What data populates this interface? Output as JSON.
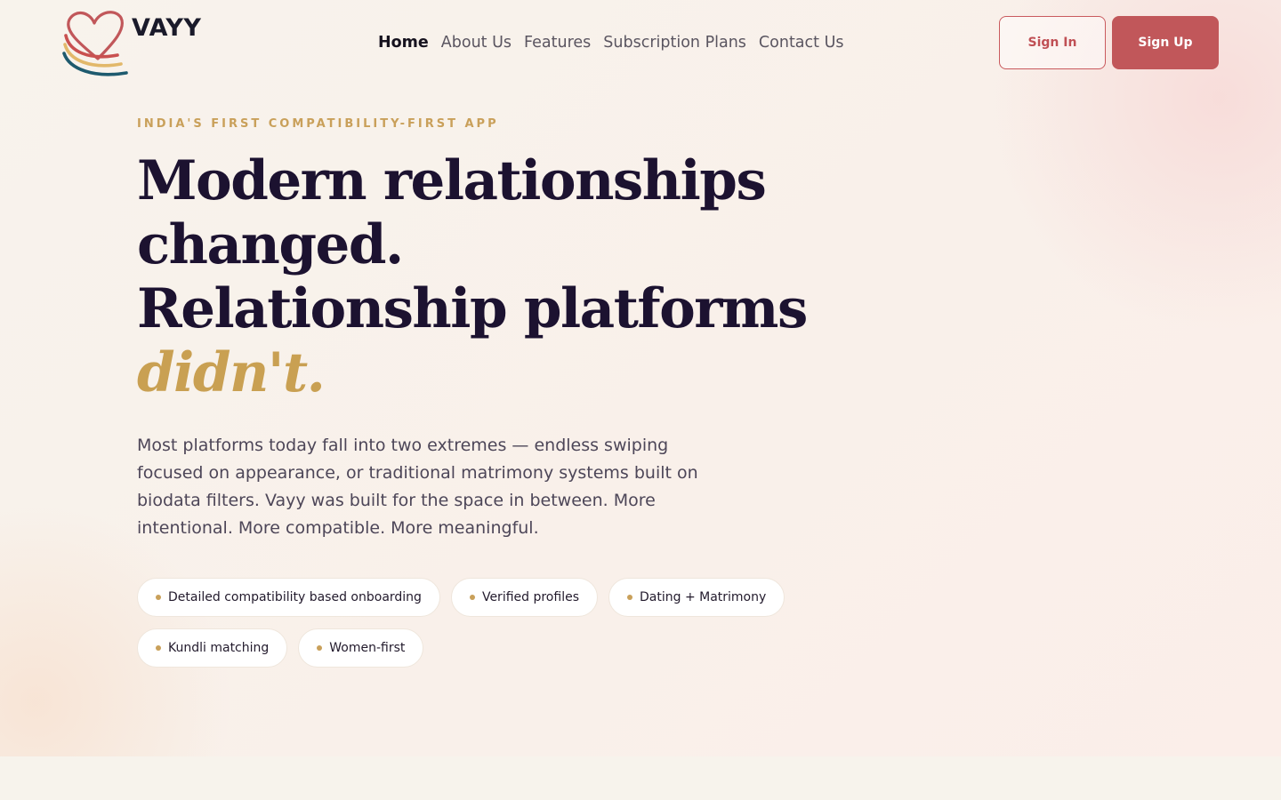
{
  "brand": {
    "name": "VAYY"
  },
  "nav": {
    "items": [
      {
        "label": "Home",
        "active": true
      },
      {
        "label": "About Us"
      },
      {
        "label": "Features"
      },
      {
        "label": "Subscription Plans"
      },
      {
        "label": "Contact Us"
      }
    ]
  },
  "auth": {
    "sign_in": "Sign In",
    "sign_up": "Sign Up"
  },
  "hero": {
    "eyebrow": "INDIA'S FIRST COMPATIBILITY-FIRST APP",
    "headline": {
      "line1": "Modern relationships",
      "line2": "changed.",
      "line3": "Relationship platforms",
      "accent": "didn't."
    },
    "body": "Most platforms today fall into two extremes — endless swiping focused on appearance, or traditional matrimony systems built on biodata filters. Vayy was built for the space in between. More intentional. More compatible. More meaningful.",
    "chips": [
      "Detailed compatibility based onboarding",
      "Verified profiles",
      "Dating + Matrimony",
      "Kundli matching",
      "Women-first"
    ]
  },
  "colors": {
    "accent_red": "#c1575a",
    "accent_gold": "#c9a05a",
    "heading": "#1c1230"
  },
  "icons": {
    "logo": "heart-ribbon-logo-icon",
    "chip_bullet": "dot-icon"
  }
}
